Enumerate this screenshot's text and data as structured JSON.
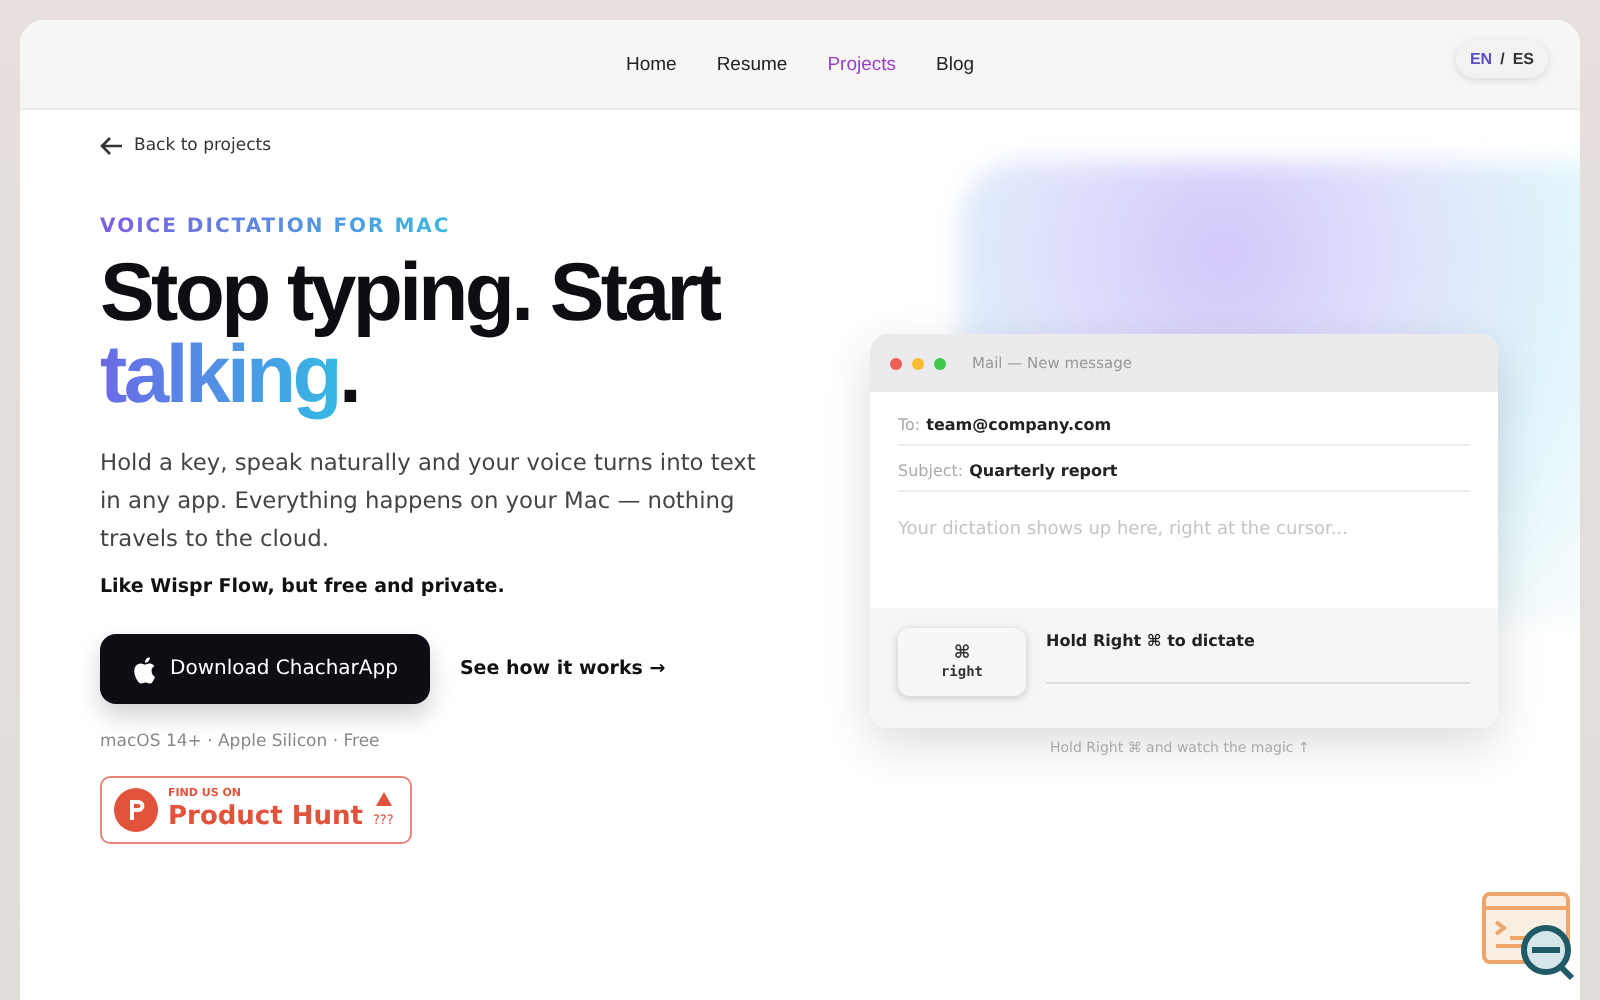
{
  "nav": {
    "items": [
      {
        "label": "Home",
        "selected": false
      },
      {
        "label": "Resume",
        "selected": false
      },
      {
        "label": "Projects",
        "selected": true
      },
      {
        "label": "Blog",
        "selected": false
      }
    ],
    "languages": [
      {
        "label": "EN",
        "selected": true
      },
      {
        "label": "ES",
        "selected": false
      }
    ],
    "separator": "/"
  },
  "back_link": "Back to projects",
  "eyebrow": "VOICE DICTATION FOR MAC",
  "headline": {
    "text": "Stop typing. Start",
    "highlight": "talking",
    "end": "."
  },
  "description": "Hold a key, speak naturally and your voice turns into text in any app. Everything happens on your Mac — nothing travels to the cloud.",
  "tagline": "Like Wispr Flow, but **free** and **private**.",
  "download_button": "Download ChacharApp",
  "how_link": "See how it works →",
  "requirements": "macOS 14+ · Apple Silicon · Free",
  "product_hunt": {
    "small": "FIND US ON",
    "name": "Product Hunt",
    "count": "???"
  },
  "mail": {
    "dots": [
      {
        "color": "#ee5f57"
      },
      {
        "color": "#f5bd2f"
      },
      {
        "color": "#3fc84a"
      }
    ],
    "title": "Mail — New message",
    "to_label": "To:",
    "to": "team@company.com",
    "subject_label": "Subject:",
    "subject": "Quarterly report",
    "placeholder": "Your dictation shows up here, right at the cursor...",
    "key_symbol": "⌘",
    "key_label": "right",
    "hint": "Hold Right ⌘ to dictate"
  },
  "caption": "Hold Right ⌘ and watch the magic ↑"
}
